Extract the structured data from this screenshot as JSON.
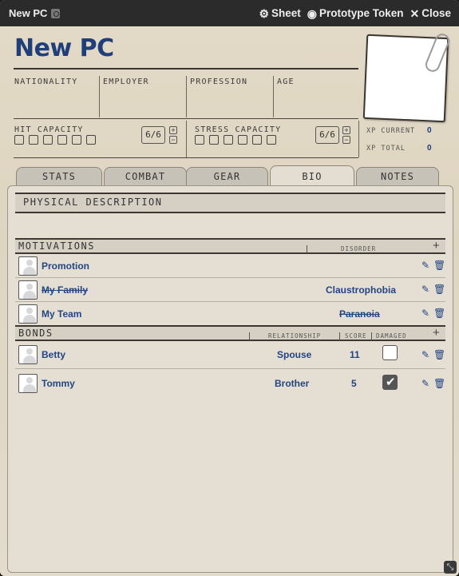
{
  "window": {
    "title": "New PC",
    "actions": {
      "sheet": "Sheet",
      "prototype_token": "Prototype Token",
      "close": "Close"
    }
  },
  "character": {
    "name": "New PC",
    "fields": {
      "nationality": "NATIONALITY",
      "employer": "EMPLOYER",
      "profession": "PROFESSION",
      "age": "AGE"
    },
    "hit_capacity": {
      "label": "HIT CAPACITY",
      "value": "6/6"
    },
    "stress_capacity": {
      "label": "STRESS CAPACITY",
      "value": "6/6"
    },
    "xp": {
      "current_label": "XP CURRENT",
      "current_value": "0",
      "total_label": "XP TOTAL",
      "total_value": "0"
    }
  },
  "tabs": [
    "STATS",
    "COMBAT",
    "GEAR",
    "BIO",
    "NOTES"
  ],
  "active_tab": "BIO",
  "bio": {
    "physical_description": "PHYSICAL DESCRIPTION",
    "motivations": {
      "title": "MOTIVATIONS",
      "col_disorder": "DISORDER",
      "items": [
        {
          "name": "Promotion",
          "disorder": "",
          "name_struck": false,
          "disorder_struck": false
        },
        {
          "name": "My Family",
          "disorder": "Claustrophobia",
          "name_struck": true,
          "disorder_struck": false
        },
        {
          "name": "My Team",
          "disorder": "Paranoia",
          "name_struck": false,
          "disorder_struck": true
        }
      ]
    },
    "bonds": {
      "title": "BONDS",
      "col_relationship": "RELATIONSHIP",
      "col_score": "SCORE",
      "col_damaged": "DAMAGED",
      "items": [
        {
          "name": "Betty",
          "relationship": "Spouse",
          "score": "11",
          "damaged": false
        },
        {
          "name": "Tommy",
          "relationship": "Brother",
          "score": "5",
          "damaged": true
        }
      ]
    }
  },
  "colors": {
    "accent_blue": "#1f3e7a",
    "link_blue": "#234583",
    "titlebar": "#2b2b2b",
    "parchment": "#e2d9c6"
  }
}
